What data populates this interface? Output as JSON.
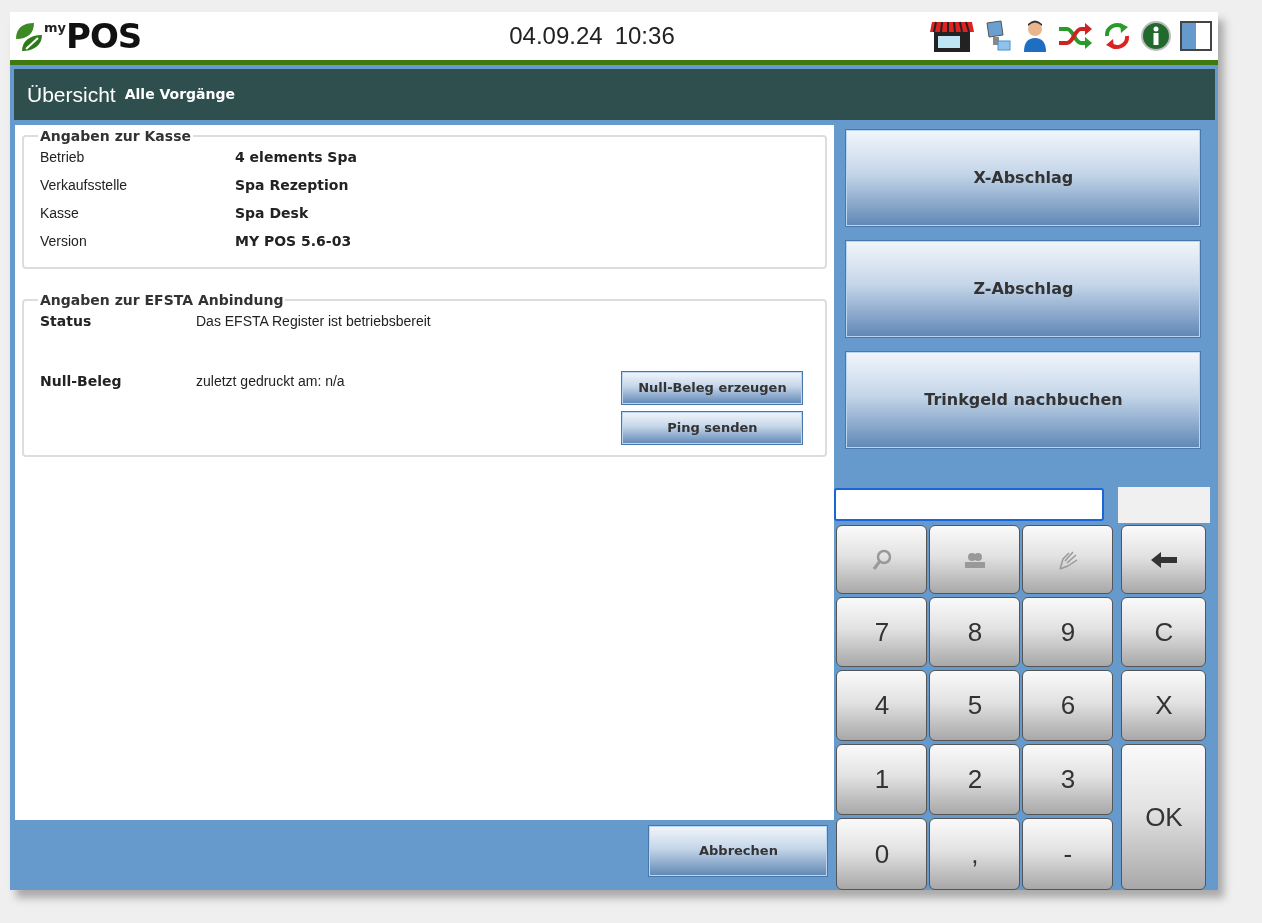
{
  "header": {
    "logo_sup": "my",
    "logo_text": "POS",
    "date": "04.09.24",
    "time": "10:36"
  },
  "title_bar": {
    "title": "Übersicht",
    "subtitle": "Alle Vorgänge"
  },
  "kasse": {
    "legend": "Angaben zur Kasse",
    "rows": [
      {
        "label": "Betrieb",
        "value": "4 elements Spa"
      },
      {
        "label": "Verkaufsstelle",
        "value": "Spa Rezeption"
      },
      {
        "label": "Kasse",
        "value": "Spa Desk"
      },
      {
        "label": "Version",
        "value": "MY POS 5.6-03"
      }
    ]
  },
  "efsta": {
    "legend": "Angaben zur EFSTA Anbindung",
    "rows": [
      {
        "label": "Status",
        "value": "Das EFSTA Register ist betriebsbereit"
      },
      {
        "label": "Null-Beleg",
        "value": "zuletzt gedruckt am: n/a"
      }
    ],
    "buttons": [
      "Null-Beleg erzeugen",
      "Ping senden"
    ]
  },
  "action_buttons": [
    "X-Abschlag",
    "Z-Abschlag",
    "Trinkgeld nachbuchen"
  ],
  "cancel_button": "Abbrechen",
  "keypad": [
    {
      "kind": "search",
      "disabled": true
    },
    {
      "kind": "people",
      "disabled": true
    },
    {
      "kind": "hand",
      "disabled": true
    },
    {
      "kind": "backspace",
      "disabled": false
    },
    {
      "kind": "text",
      "label": "7",
      "disabled": false
    },
    {
      "kind": "text",
      "label": "8",
      "disabled": false
    },
    {
      "kind": "text",
      "label": "9",
      "disabled": false
    },
    {
      "kind": "text",
      "label": "C",
      "disabled": false
    },
    {
      "kind": "text",
      "label": "4",
      "disabled": false
    },
    {
      "kind": "text",
      "label": "5",
      "disabled": false
    },
    {
      "kind": "text",
      "label": "6",
      "disabled": false
    },
    {
      "kind": "text",
      "label": "X",
      "disabled": false
    },
    {
      "kind": "text",
      "label": "1",
      "disabled": false
    },
    {
      "kind": "text",
      "label": "2",
      "disabled": false
    },
    {
      "kind": "text",
      "label": "3",
      "disabled": false
    },
    {
      "kind": "enter",
      "label": "OK",
      "disabled": false
    },
    {
      "kind": "text",
      "label": "0",
      "disabled": false
    },
    {
      "kind": "text",
      "label": ",",
      "disabled": false
    },
    {
      "kind": "text",
      "label": "-",
      "disabled": false
    }
  ]
}
